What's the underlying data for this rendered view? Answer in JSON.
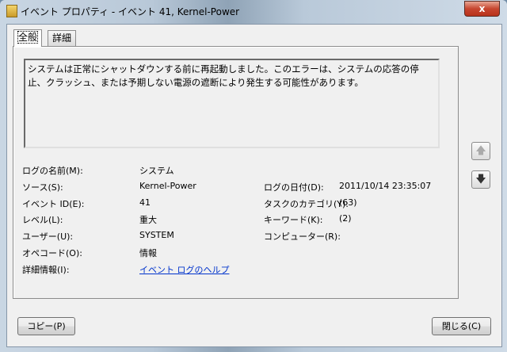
{
  "window": {
    "title": "イベント プロパティ - イベント 41, Kernel-Power",
    "close_label": "x"
  },
  "tabs": [
    {
      "label": "全般"
    },
    {
      "label": "詳細"
    }
  ],
  "description": "システムは正常にシャットダウンする前に再起動しました。このエラーは、システムの応答の停止、クラッシュ、または予期しない電源の遮断により発生する可能性があります。",
  "fields": {
    "log_name": {
      "label": "ログの名前(M):",
      "value": "システム"
    },
    "source": {
      "label": "ソース(S):",
      "value": "Kernel-Power"
    },
    "event_id": {
      "label": "イベント ID(E):",
      "value": "41"
    },
    "level": {
      "label": "レベル(L):",
      "value": "重大"
    },
    "user": {
      "label": "ユーザー(U):",
      "value": "SYSTEM"
    },
    "opcode": {
      "label": "オペコード(O):",
      "value": "情報"
    },
    "more_info": {
      "label": "詳細情報(I):",
      "value": "イベント ログのヘルプ"
    },
    "logged": {
      "label": "ログの日付(D):",
      "value": "2011/10/14 23:35:07"
    },
    "task_category": {
      "label": "タスクのカテゴリ(Y):",
      "value": "(63)"
    },
    "keywords": {
      "label": "キーワード(K):",
      "value": "(2)"
    },
    "computer": {
      "label": "コンピューター(R):",
      "value": ""
    }
  },
  "buttons": {
    "copy": "コピー(P)",
    "close": "閉じる(C)",
    "up": "🡅",
    "down": "🡇"
  }
}
